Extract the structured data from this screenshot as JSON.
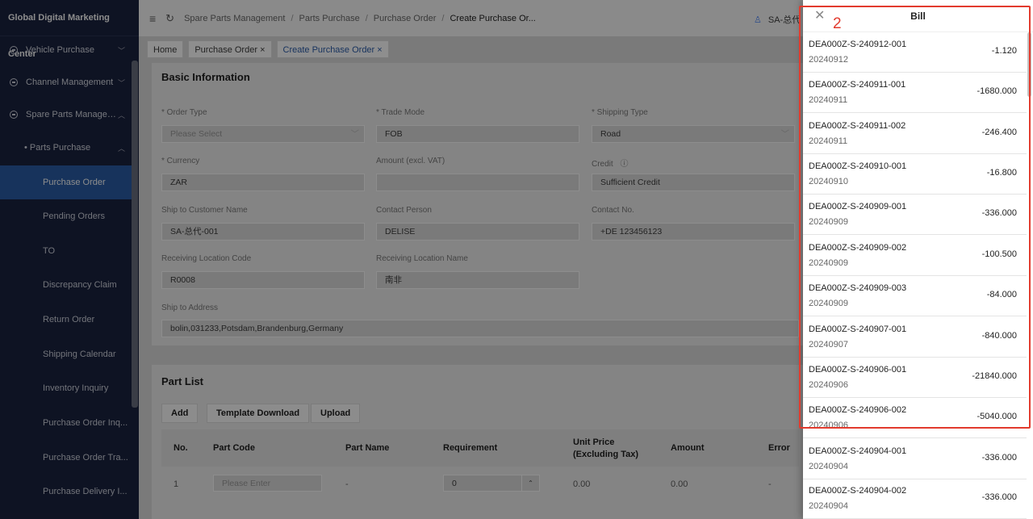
{
  "sidebar": {
    "brand": "Global Digital Marketing Center",
    "groups": [
      {
        "label": "Vehicle Purchase",
        "chevron": "chevron-down"
      },
      {
        "label": "Channel Management",
        "chevron": "chevron-down"
      },
      {
        "label": "Spare Parts Manage…",
        "chevron": "chevron-up"
      }
    ],
    "subgroup": {
      "label": "• Parts Purchase",
      "chevron": "chevron-up"
    },
    "items": [
      {
        "label": "Purchase Order"
      },
      {
        "label": "Pending Orders"
      },
      {
        "label": "TO"
      },
      {
        "label": "Discrepancy Claim"
      },
      {
        "label": "Return Order"
      },
      {
        "label": "Shipping Calendar"
      },
      {
        "label": "Inventory Inquiry"
      },
      {
        "label": "Purchase Order Inq..."
      },
      {
        "label": "Purchase Order Tra..."
      },
      {
        "label": "Purchase Delivery I..."
      }
    ]
  },
  "topbar": {
    "menu_icon": "≡",
    "refresh_icon": "↻",
    "breadcrumb": [
      "Spare Parts Management",
      "Parts Purchase",
      "Purchase Order",
      "Create Purchase Or..."
    ],
    "user": "SA-总代"
  },
  "tabs": [
    {
      "label": "Home",
      "closable": false
    },
    {
      "label": "Purchase Order",
      "closable": true
    },
    {
      "label": "Create Purchase Order",
      "closable": true
    }
  ],
  "basic": {
    "title": "Basic Information",
    "order_type_label": "* Order Type",
    "order_type_placeholder": "Please Select",
    "trade_mode_label": "* Trade Mode",
    "trade_mode_value": "FOB",
    "shipping_type_label": "* Shipping Type",
    "shipping_type_value": "Road",
    "currency_label": "* Currency",
    "currency_value": "ZAR",
    "amount_label": "Amount (excl. VAT)",
    "amount_value": "",
    "credit_label": "Credit",
    "credit_value": "Sufficient Credit",
    "ship_name_label": "Ship to Customer Name",
    "ship_name_value": "SA-总代-001",
    "contact_person_label": "Contact Person",
    "contact_person_value": "DELISE",
    "contact_no_label": "Contact No.",
    "contact_no_value": "+DE 123456123",
    "recv_code_label": "Receiving Location Code",
    "recv_code_value": "R0008",
    "recv_name_label": "Receiving Location Name",
    "recv_name_value": "南非",
    "address_label": "Ship to Address",
    "address_value": "bolin,031233,Potsdam,Brandenburg,Germany"
  },
  "parts": {
    "title": "Part List",
    "add_label": "Add",
    "template_label": "Template Download",
    "upload_label": "Upload",
    "columns": [
      "No.",
      "Part Code",
      "Part Name",
      "Requirement",
      "Unit Price (Excluding Tax)",
      "Amount",
      "Error"
    ],
    "row": {
      "no": "1",
      "part_code_placeholder": "Please Enter",
      "part_name": "-",
      "requirement": "0",
      "unit_price": "0.00",
      "amount": "0.00",
      "error": "-"
    }
  },
  "drawer": {
    "title": "Bill",
    "close_icon": "✕",
    "highlight_number": "2",
    "bills": [
      {
        "code": "DEA000Z-S-240912-001",
        "date": "20240912",
        "amount": "-1.120"
      },
      {
        "code": "DEA000Z-S-240911-001",
        "date": "20240911",
        "amount": "-1680.000"
      },
      {
        "code": "DEA000Z-S-240911-002",
        "date": "20240911",
        "amount": "-246.400"
      },
      {
        "code": "DEA000Z-S-240910-001",
        "date": "20240910",
        "amount": "-16.800"
      },
      {
        "code": "DEA000Z-S-240909-001",
        "date": "20240909",
        "amount": "-336.000"
      },
      {
        "code": "DEA000Z-S-240909-002",
        "date": "20240909",
        "amount": "-100.500"
      },
      {
        "code": "DEA000Z-S-240909-003",
        "date": "20240909",
        "amount": "-84.000"
      },
      {
        "code": "DEA000Z-S-240907-001",
        "date": "20240907",
        "amount": "-840.000"
      },
      {
        "code": "DEA000Z-S-240906-001",
        "date": "20240906",
        "amount": "-21840.000"
      },
      {
        "code": "DEA000Z-S-240906-002",
        "date": "20240906",
        "amount": "-5040.000"
      },
      {
        "code": "DEA000Z-S-240904-001",
        "date": "20240904",
        "amount": "-336.000"
      },
      {
        "code": "DEA000Z-S-240904-002",
        "date": "20240904",
        "amount": "-336.000"
      }
    ]
  }
}
